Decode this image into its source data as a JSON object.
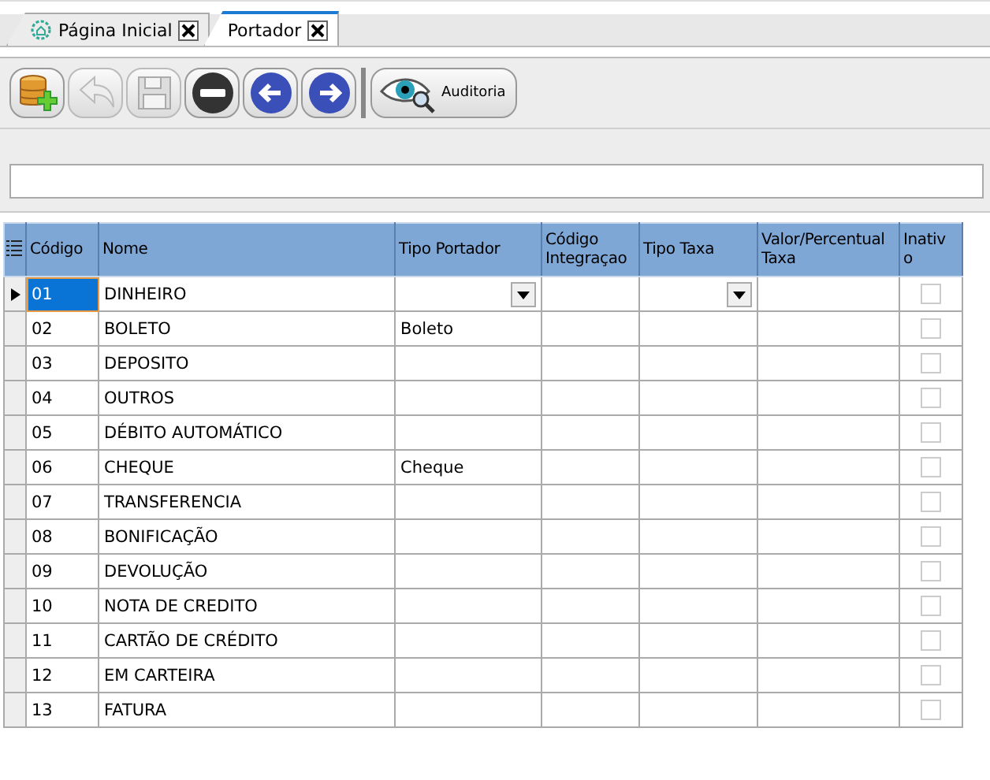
{
  "tabs": [
    {
      "label": "Página Inicial",
      "selected": false,
      "kind": "home"
    },
    {
      "label": "Portador",
      "selected": true,
      "kind": "plain"
    }
  ],
  "toolbar": {
    "buttons": [
      {
        "kind": "add",
        "disabled": false
      },
      {
        "kind": "undo",
        "disabled": true
      },
      {
        "kind": "save",
        "disabled": true
      },
      {
        "kind": "delete",
        "disabled": false
      },
      {
        "kind": "prev",
        "disabled": false
      },
      {
        "kind": "next",
        "disabled": false
      },
      {
        "kind": "audit",
        "label": "Auditoria",
        "disabled": false
      }
    ]
  },
  "table": {
    "columns": [
      "Código",
      "Nome",
      "Tipo Portador",
      "Código Integraçao",
      "Tipo Taxa",
      "Valor/Percentual Taxa",
      "Inativ o"
    ],
    "rows": [
      {
        "codigo": "01",
        "nome": "DINHEIRO",
        "selected": true,
        "inativo": false
      },
      {
        "codigo": "02",
        "nome": "BOLETO",
        "tipo_portador": "Boleto",
        "selected": false,
        "inativo": false
      },
      {
        "codigo": "03",
        "nome": "DEPOSITO",
        "selected": false,
        "inativo": false
      },
      {
        "codigo": "04",
        "nome": "OUTROS",
        "selected": false,
        "inativo": false
      },
      {
        "codigo": "05",
        "nome": "DÉBITO AUTOMÁTICO",
        "selected": false,
        "inativo": false
      },
      {
        "codigo": "06",
        "nome": "CHEQUE",
        "tipo_portador": "Cheque",
        "selected": false,
        "inativo": false
      },
      {
        "codigo": "07",
        "nome": "TRANSFERENCIA",
        "selected": false,
        "inativo": false
      },
      {
        "codigo": "08",
        "nome": "BONIFICAÇÃO",
        "selected": false,
        "inativo": false
      },
      {
        "codigo": "09",
        "nome": "DEVOLUÇÃO",
        "selected": false,
        "inativo": false
      },
      {
        "codigo": "10",
        "nome": "NOTA DE CREDITO",
        "selected": false,
        "inativo": false
      },
      {
        "codigo": "11",
        "nome": "CARTÃO DE CRÉDITO",
        "selected": false,
        "inativo": false
      },
      {
        "codigo": "12",
        "nome": "EM CARTEIRA",
        "selected": false,
        "inativo": false
      },
      {
        "codigo": "13",
        "nome": "FATURA",
        "selected": false,
        "inativo": false
      }
    ]
  }
}
